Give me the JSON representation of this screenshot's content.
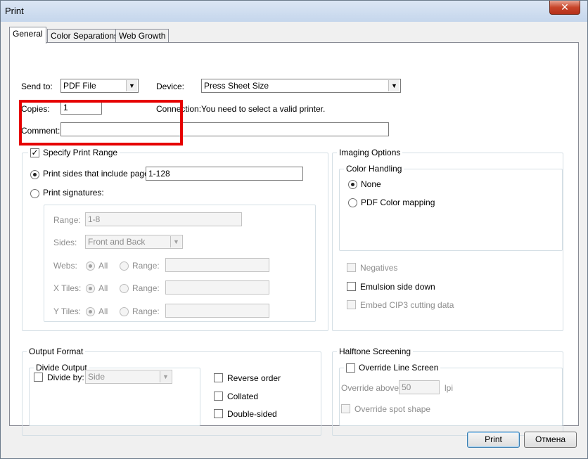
{
  "window": {
    "title": "Print",
    "close_glyph": "✕"
  },
  "tabs": [
    {
      "label": "General",
      "active": true
    },
    {
      "label": "Color Separations",
      "active": false
    },
    {
      "label": "Web Growth",
      "active": false
    }
  ],
  "general": {
    "send_to": {
      "label": "Send to:",
      "value": "PDF File"
    },
    "device": {
      "label": "Device:",
      "value": "Press Sheet Size"
    },
    "copies": {
      "label": "Copies:",
      "value": "1"
    },
    "connection": {
      "label": "Connection:",
      "value": "You need to select a valid printer."
    },
    "comment": {
      "label": "Comment:",
      "value": ""
    }
  },
  "print_range": {
    "specify_label": "Specify Print Range",
    "specify_checked": true,
    "sides_label": "Print sides that include pages:",
    "sides_value": "1-128",
    "signatures_label": "Print signatures:",
    "range_label": "Range:",
    "range_value": "1-8",
    "sides_field_label": "Sides:",
    "sides_field_value": "Front and Back",
    "webs_label": "Webs:",
    "xtiles_label": "X Tiles:",
    "ytiles_label": "Y Tiles:",
    "all_label": "All",
    "range_option_label": "Range:"
  },
  "imaging": {
    "title": "Imaging Options",
    "color_handling_title": "Color Handling",
    "none_label": "None",
    "pdf_mapping_label": "PDF Color mapping",
    "negatives_label": "Negatives",
    "emulsion_label": "Emulsion side down",
    "cip3_label": "Embed CIP3 cutting data"
  },
  "output": {
    "title": "Output Format",
    "divide_output_title": "Divide Output",
    "divide_by_label": "Divide by:",
    "divide_by_value": "Side",
    "reverse_label": "Reverse order",
    "collated_label": "Collated",
    "double_sided_label": "Double-sided"
  },
  "halftone": {
    "title": "Halftone Screening",
    "override_line_label": "Override Line Screen",
    "override_above_label": "Override above:",
    "override_above_value": "50",
    "lpi_label": "lpi",
    "override_spot_label": "Override spot shape"
  },
  "buttons": {
    "print": "Print",
    "cancel": "Отмена"
  },
  "colors": {
    "highlight": "#e60000",
    "close_button": "#c7452a"
  }
}
